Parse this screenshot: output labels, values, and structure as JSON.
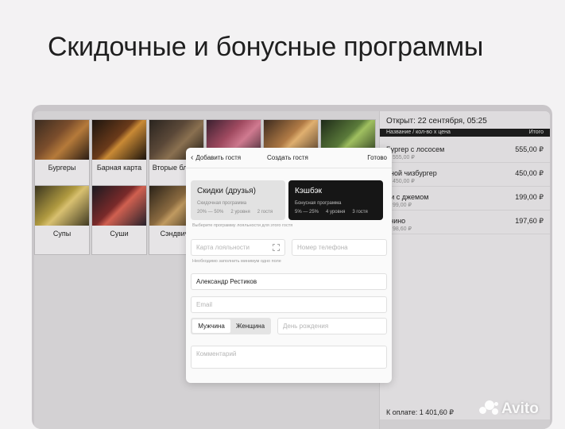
{
  "slide": {
    "title": "Скидочные и бонусные программы"
  },
  "menu": {
    "categories": [
      {
        "label": "Бургеры"
      },
      {
        "label": "Барная карта"
      },
      {
        "label": "Вторые блюда"
      },
      {
        "label": ""
      },
      {
        "label": ""
      },
      {
        "label": ""
      },
      {
        "label": "Супы"
      },
      {
        "label": "Суши"
      },
      {
        "label": "Сэндвичи"
      }
    ]
  },
  "order": {
    "opened": "Открыт: 22 сентября, 05:25",
    "header_name": "Название / кол-во x цена",
    "header_total": "Итого",
    "items": [
      {
        "name": "Бургер с лососем",
        "sub": "555,00 ₽",
        "price": "555,00 ₽"
      },
      {
        "name": "йной чизбургер",
        "sub": "450,00 ₽",
        "price": "450,00 ₽"
      },
      {
        "name": "ли с джемом",
        "sub": "99,00 ₽",
        "price": "199,00 ₽"
      },
      {
        "name": "учино",
        "sub": "98,60 ₽",
        "price": "197,60 ₽"
      }
    ],
    "total": "К оплате: 1 401,60 ₽"
  },
  "modal": {
    "back": "Добавить гостя",
    "title": "Создать гостя",
    "done": "Готово",
    "programs": [
      {
        "title": "Скидки (друзья)",
        "subtitle": "Скидочная программа",
        "d1": "20% — 50%",
        "d2": "2 уровня",
        "d3": "2 гостя"
      },
      {
        "title": "Кэшбэк",
        "subtitle": "Бонусная программа",
        "d1": "5% — 25%",
        "d2": "4 уровня",
        "d3": "3 гостя"
      }
    ],
    "program_hint": "Выберите программу лояльности для этого гостя",
    "card_placeholder": "Карта лояльности",
    "phone_placeholder": "Номер телефона",
    "fill_hint": "Необходимо заполнить минимум одно поле",
    "name_value": "Александр Рестиков",
    "email_placeholder": "Email",
    "gender_male": "Мужчина",
    "gender_female": "Женщина",
    "birthday_placeholder": "День рождения",
    "comment_placeholder": "Комментарий"
  },
  "watermark": {
    "text": "Avito"
  }
}
